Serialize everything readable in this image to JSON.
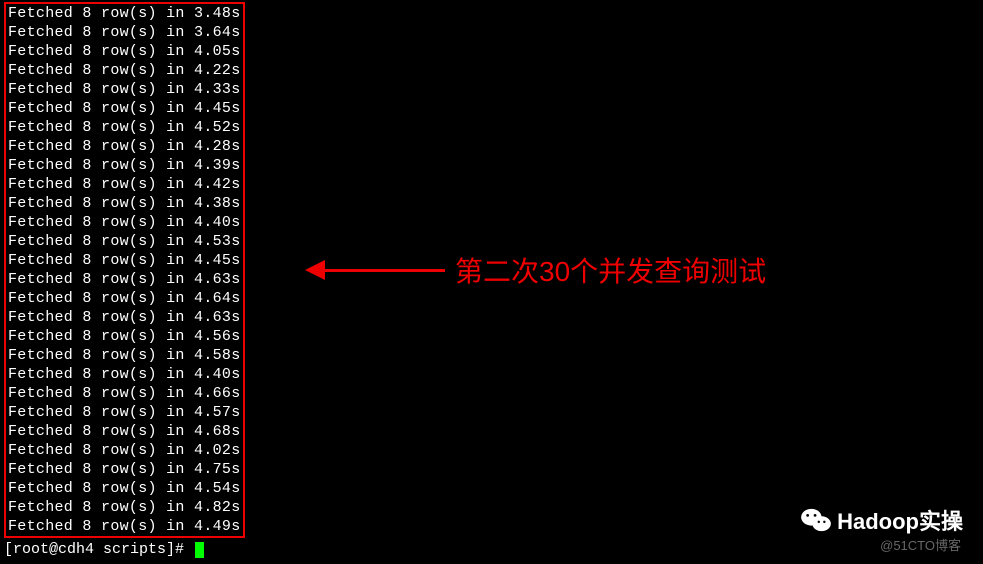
{
  "terminal": {
    "lines": [
      "Fetched 8 row(s) in 3.48s",
      "Fetched 8 row(s) in 3.64s",
      "Fetched 8 row(s) in 4.05s",
      "Fetched 8 row(s) in 4.22s",
      "Fetched 8 row(s) in 4.33s",
      "Fetched 8 row(s) in 4.45s",
      "Fetched 8 row(s) in 4.52s",
      "Fetched 8 row(s) in 4.28s",
      "Fetched 8 row(s) in 4.39s",
      "Fetched 8 row(s) in 4.42s",
      "Fetched 8 row(s) in 4.38s",
      "Fetched 8 row(s) in 4.40s",
      "Fetched 8 row(s) in 4.53s",
      "Fetched 8 row(s) in 4.45s",
      "Fetched 8 row(s) in 4.63s",
      "Fetched 8 row(s) in 4.64s",
      "Fetched 8 row(s) in 4.63s",
      "Fetched 8 row(s) in 4.56s",
      "Fetched 8 row(s) in 4.58s",
      "Fetched 8 row(s) in 4.40s",
      "Fetched 8 row(s) in 4.66s",
      "Fetched 8 row(s) in 4.57s",
      "Fetched 8 row(s) in 4.68s",
      "Fetched 8 row(s) in 4.02s",
      "Fetched 8 row(s) in 4.75s",
      "Fetched 8 row(s) in 4.54s",
      "Fetched 8 row(s) in 4.82s",
      "Fetched 8 row(s) in 4.49s"
    ],
    "prompt": "[root@cdh4 scripts]# "
  },
  "annotation": {
    "text": "第二次30个并发查询测试"
  },
  "watermark": {
    "logo_text": "Hadoop实操",
    "sub_text": "@51CTO博客"
  }
}
